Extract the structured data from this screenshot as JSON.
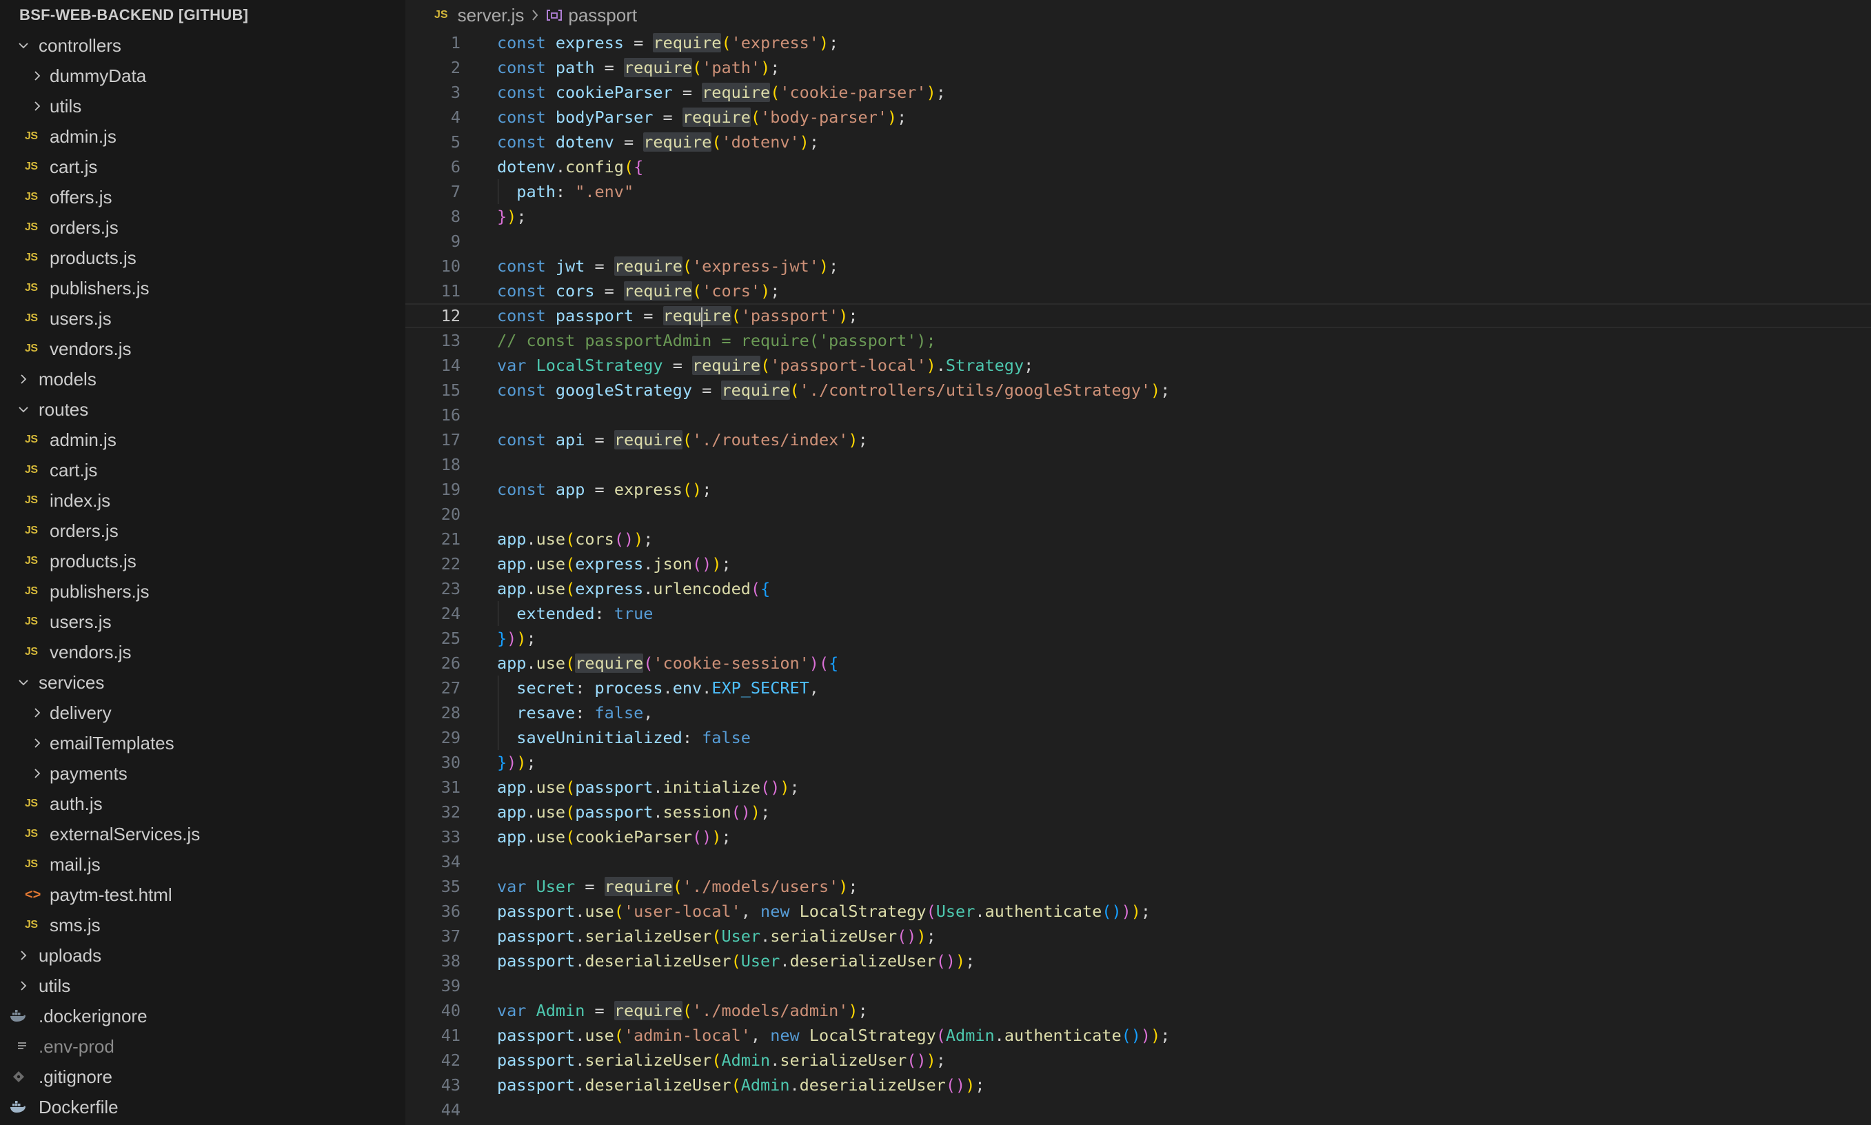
{
  "explorer": {
    "title": "BSF-WEB-BACKEND [GITHUB]",
    "items": [
      {
        "label": "controllers",
        "kind": "folder",
        "open": true,
        "depth": 0
      },
      {
        "label": "dummyData",
        "kind": "folder",
        "open": false,
        "depth": 1
      },
      {
        "label": "utils",
        "kind": "folder",
        "open": false,
        "depth": 1
      },
      {
        "label": "admin.js",
        "kind": "js",
        "depth": 1
      },
      {
        "label": "cart.js",
        "kind": "js",
        "depth": 1
      },
      {
        "label": "offers.js",
        "kind": "js",
        "depth": 1
      },
      {
        "label": "orders.js",
        "kind": "js",
        "depth": 1
      },
      {
        "label": "products.js",
        "kind": "js",
        "depth": 1
      },
      {
        "label": "publishers.js",
        "kind": "js",
        "depth": 1
      },
      {
        "label": "users.js",
        "kind": "js",
        "depth": 1
      },
      {
        "label": "vendors.js",
        "kind": "js",
        "depth": 1
      },
      {
        "label": "models",
        "kind": "folder",
        "open": false,
        "depth": 0
      },
      {
        "label": "routes",
        "kind": "folder",
        "open": true,
        "depth": 0
      },
      {
        "label": "admin.js",
        "kind": "js",
        "depth": 1
      },
      {
        "label": "cart.js",
        "kind": "js",
        "depth": 1
      },
      {
        "label": "index.js",
        "kind": "js",
        "depth": 1
      },
      {
        "label": "orders.js",
        "kind": "js",
        "depth": 1
      },
      {
        "label": "products.js",
        "kind": "js",
        "depth": 1
      },
      {
        "label": "publishers.js",
        "kind": "js",
        "depth": 1
      },
      {
        "label": "users.js",
        "kind": "js",
        "depth": 1
      },
      {
        "label": "vendors.js",
        "kind": "js",
        "depth": 1
      },
      {
        "label": "services",
        "kind": "folder",
        "open": true,
        "depth": 0
      },
      {
        "label": "delivery",
        "kind": "folder",
        "open": false,
        "depth": 1
      },
      {
        "label": "emailTemplates",
        "kind": "folder",
        "open": false,
        "depth": 1
      },
      {
        "label": "payments",
        "kind": "folder",
        "open": false,
        "depth": 1
      },
      {
        "label": "auth.js",
        "kind": "js",
        "depth": 1
      },
      {
        "label": "externalServices.js",
        "kind": "js",
        "depth": 1
      },
      {
        "label": "mail.js",
        "kind": "js",
        "depth": 1
      },
      {
        "label": "paytm-test.html",
        "kind": "html",
        "depth": 1
      },
      {
        "label": "sms.js",
        "kind": "js",
        "depth": 1
      },
      {
        "label": "uploads",
        "kind": "folder",
        "open": false,
        "depth": 0
      },
      {
        "label": "utils",
        "kind": "folder",
        "open": false,
        "depth": 0
      },
      {
        "label": ".dockerignore",
        "kind": "docker",
        "depth": 0
      },
      {
        "label": ".env-prod",
        "kind": "env",
        "depth": 0,
        "dim": true
      },
      {
        "label": ".gitignore",
        "kind": "git",
        "depth": 0
      },
      {
        "label": "Dockerfile",
        "kind": "docker",
        "depth": 0
      }
    ]
  },
  "breadcrumbs": {
    "file_icon": "JS",
    "file": "server.js",
    "symbol": "passport"
  },
  "editor": {
    "current_line": 12,
    "lines": [
      "const express = require('express');",
      "const path = require('path');",
      "const cookieParser = require('cookie-parser');",
      "const bodyParser = require('body-parser');",
      "const dotenv = require('dotenv');",
      "dotenv.config({",
      "  path: \".env\"",
      "});",
      "",
      "const jwt = require('express-jwt');",
      "const cors = require('cors');",
      "const passport = require('passport');",
      "// const passportAdmin = require('passport');",
      "var LocalStrategy = require('passport-local').Strategy;",
      "const googleStrategy = require('./controllers/utils/googleStrategy');",
      "",
      "const api = require('./routes/index');",
      "",
      "const app = express();",
      "",
      "app.use(cors());",
      "app.use(express.json());",
      "app.use(express.urlencoded({",
      "  extended: true",
      "}));",
      "app.use(require('cookie-session')({",
      "  secret: process.env.EXP_SECRET,",
      "  resave: false,",
      "  saveUninitialized: false",
      "}));",
      "app.use(passport.initialize());",
      "app.use(passport.session());",
      "app.use(cookieParser());",
      "",
      "var User = require('./models/users');",
      "passport.use('user-local', new LocalStrategy(User.authenticate()));",
      "passport.serializeUser(User.serializeUser());",
      "passport.deserializeUser(User.deserializeUser());",
      "",
      "var Admin = require('./models/admin');",
      "passport.use('admin-local', new LocalStrategy(Admin.authenticate()));",
      "passport.serializeUser(Admin.serializeUser());",
      "passport.deserializeUser(Admin.deserializeUser());",
      ""
    ]
  },
  "colors": {
    "keyword": "#569cd6",
    "variable": "#9cdcfe",
    "function": "#dcdcaa",
    "string": "#ce9178",
    "comment": "#6a9955",
    "js_icon": "#d6b93a"
  }
}
